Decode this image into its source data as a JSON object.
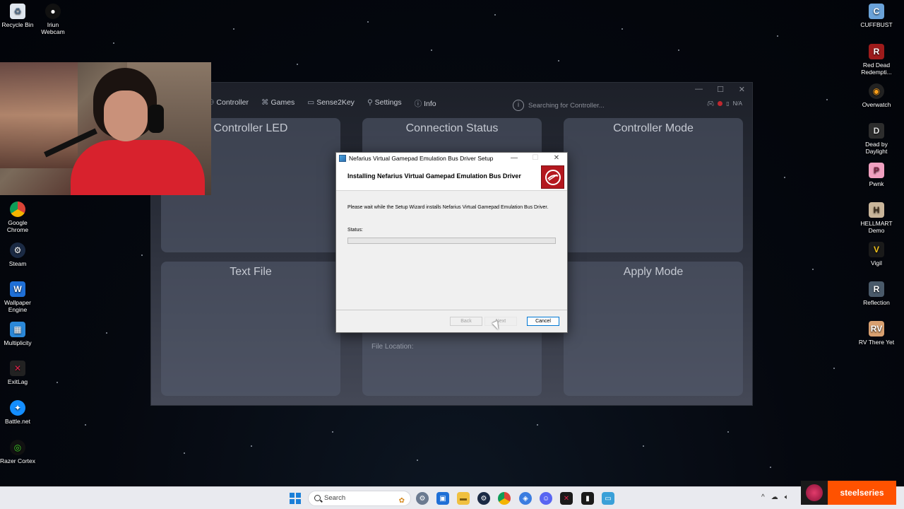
{
  "desktop": {
    "left_icons": [
      {
        "label": "Recycle Bin",
        "icon": "recycle-bin-icon"
      },
      {
        "label": "Iriun\nWebcam",
        "icon": "webcam-icon"
      },
      {
        "label": "Google\nChrome",
        "icon": "chrome-icon"
      },
      {
        "label": "Steam",
        "icon": "steam-icon"
      },
      {
        "label": "Wallpaper\nEngine",
        "icon": "wallpaper-engine-icon"
      },
      {
        "label": "Multiplicity",
        "icon": "multiplicity-icon"
      },
      {
        "label": "ExitLag",
        "icon": "exitlag-icon"
      },
      {
        "label": "Battle.net",
        "icon": "battlenet-icon"
      },
      {
        "label": "Razer Cortex",
        "icon": "razer-cortex-icon"
      }
    ],
    "right_icons": [
      {
        "label": "CUFFBUST",
        "icon": "cuffbust-icon"
      },
      {
        "label": "Red Dead\nRedempti...",
        "icon": "red-dead-icon"
      },
      {
        "label": "Overwatch",
        "icon": "overwatch-icon"
      },
      {
        "label": "Dead by\nDaylight",
        "icon": "dead-by-daylight-icon"
      },
      {
        "label": "Pwnk",
        "icon": "pwnk-icon"
      },
      {
        "label": "HELLMART\nDemo",
        "icon": "hellmart-icon"
      },
      {
        "label": "Vigil",
        "icon": "vigil-icon"
      },
      {
        "label": "Reflection",
        "icon": "reflection-icon"
      },
      {
        "label": "RV There Yet",
        "icon": "rv-there-yet-icon"
      }
    ]
  },
  "app": {
    "nav": [
      {
        "label": "Controller",
        "icon": "controller-icon"
      },
      {
        "label": "Games",
        "icon": "games-icon"
      },
      {
        "label": "Sense2Key",
        "icon": "keyboard-icon"
      },
      {
        "label": "Settings",
        "icon": "settings-icon"
      },
      {
        "label": "Info",
        "icon": "info-icon"
      }
    ],
    "status_text": "Searching for Controller...",
    "battery_text": "N/A",
    "panels": {
      "controller_led": "Controller LED",
      "connection_status": "Connection Status",
      "controller_mode": "Controller Mode",
      "text_file": "Text File",
      "apply_mode": "Apply Mode"
    },
    "file_location_label": "File Location:"
  },
  "dialog": {
    "title": "Nefarius Virtual Gamepad Emulation Bus Driver Setup",
    "heading": "Installing Nefarius Virtual Gamepad Emulation Bus Driver",
    "message": "Please wait while the Setup Wizard installs Nefarius Virtual Gamepad Emulation Bus Driver.",
    "status_label": "Status:",
    "progress": 0.0,
    "back_label": "Back",
    "next_label": "Next",
    "cancel_label": "Cancel"
  },
  "taskbar": {
    "search_placeholder": "Search",
    "apps": [
      "settings-icon",
      "store-icon",
      "file-explorer-icon",
      "steam-icon",
      "chrome-icon",
      "arc-icon",
      "discord-icon",
      "exitlag-icon",
      "terminal-icon",
      "remote-desktop-icon"
    ]
  },
  "overlay": {
    "steelseries_label": "steelseries",
    "accent": "#ff5200"
  }
}
